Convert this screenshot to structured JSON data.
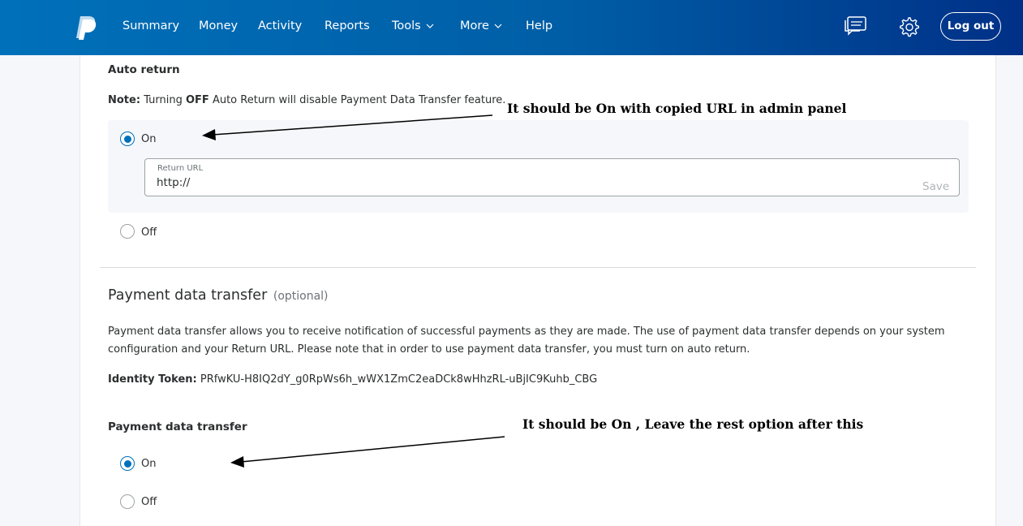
{
  "header": {
    "nav": [
      {
        "label": "Summary"
      },
      {
        "label": "Money"
      },
      {
        "label": "Activity"
      },
      {
        "label": "Reports"
      },
      {
        "label": "Tools"
      },
      {
        "label": "More"
      },
      {
        "label": "Help"
      }
    ],
    "logout_label": "Log out",
    "icons": [
      "paypal-logo",
      "message-center-icon",
      "settings-gear-icon"
    ],
    "brand_color": "#0070ba"
  },
  "auto_return": {
    "heading": "Auto return",
    "note_prefix": "Note:",
    "note_text_1": "Turning",
    "note_off": "OFF",
    "note_text_2": "Auto Return will disable Payment Data Transfer feature.",
    "option_on": "On",
    "option_off": "Off",
    "selected": "On",
    "return_url_label": "Return URL",
    "return_url_value": "http://",
    "save_label": "Save"
  },
  "pdt": {
    "title": "Payment data transfer",
    "optional": "(optional)",
    "description_line1": "Payment data transfer allows you to receive notification of successful payments as they are made. The use of payment data transfer depends on your system",
    "description_line2": "configuration and your Return URL. Please note that in order to use payment data transfer, you must turn on auto return.",
    "identity_label": "Identity Token:",
    "identity_value": "PRfwKU-H8IQ2dY_g0RpWs6h_wWX1ZmC2eaDCk8wHhzRL-uBjIC9Kuhb_CBG",
    "heading": "Payment data transfer",
    "option_on": "On",
    "option_off": "Off",
    "selected": "On"
  },
  "annotations": {
    "note1": "It should be On with copied URL in admin panel",
    "note2": "It should be On , Leave the rest option after this"
  }
}
